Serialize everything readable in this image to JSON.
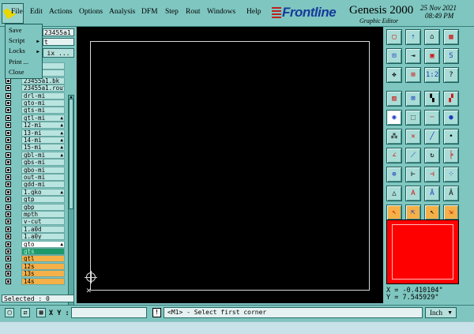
{
  "menubar": {
    "items": [
      "File",
      "Edit",
      "Actions",
      "Options",
      "Analysis",
      "DFM",
      "Step",
      "Rout",
      "Windows",
      "Help"
    ]
  },
  "logo": {
    "brand": "Frontline",
    "product": "Genesis 2000",
    "subtitle": "Graphic Editor",
    "date": "25 Nov 2021",
    "time": "08:49 PM"
  },
  "file_menu": {
    "items": [
      "Save",
      "Script",
      "Locks",
      "Print ...",
      "Close"
    ]
  },
  "left_panel": {
    "job": "23455a1",
    "step": "t",
    "matrix_button": "ix ...",
    "selected_label": "Selected : 0"
  },
  "layers": [
    {
      "name": "1.drl",
      "style": "normal",
      "tag": ""
    },
    {
      "name": ".si",
      "style": "normal",
      "tag": ""
    },
    {
      "name": "23455a1.bk",
      "style": "normal",
      "tag": ""
    },
    {
      "name": "23455a1.rout",
      "style": "normal",
      "tag": ""
    },
    {
      "name": "drl-mi",
      "style": "normal",
      "tag": ""
    },
    {
      "name": "gto-mi",
      "style": "normal",
      "tag": ""
    },
    {
      "name": "gts-mi",
      "style": "normal",
      "tag": ""
    },
    {
      "name": "gtl-mi",
      "style": "normal",
      "tag": "▲"
    },
    {
      "name": "12-mi",
      "style": "normal",
      "tag": "▲"
    },
    {
      "name": "13-mi",
      "style": "normal",
      "tag": "▲"
    },
    {
      "name": "14-mi",
      "style": "normal",
      "tag": "▲"
    },
    {
      "name": "15-mi",
      "style": "normal",
      "tag": "▲"
    },
    {
      "name": "gbl-mi",
      "style": "normal",
      "tag": "▲"
    },
    {
      "name": "gbs-mi",
      "style": "normal",
      "tag": ""
    },
    {
      "name": "gbo-mi",
      "style": "normal",
      "tag": ""
    },
    {
      "name": "out-mi",
      "style": "normal",
      "tag": ""
    },
    {
      "name": "gdd-mi",
      "style": "normal",
      "tag": ""
    },
    {
      "name": "1.gko",
      "style": "normal",
      "tag": "▲"
    },
    {
      "name": "gtp",
      "style": "normal",
      "tag": ""
    },
    {
      "name": "gbp",
      "style": "normal",
      "tag": ""
    },
    {
      "name": "mpth",
      "style": "normal",
      "tag": ""
    },
    {
      "name": "v-cut",
      "style": "normal",
      "tag": ""
    },
    {
      "name": "1.a0d",
      "style": "normal",
      "tag": ""
    },
    {
      "name": "1.a0y",
      "style": "normal",
      "tag": ""
    },
    {
      "name": "gto",
      "style": "white",
      "tag": "▲"
    },
    {
      "name": "gts",
      "style": "green",
      "tag": ""
    },
    {
      "name": "gtl",
      "style": "orange",
      "tag": ""
    },
    {
      "name": "12s",
      "style": "orange",
      "tag": ""
    },
    {
      "name": "13s",
      "style": "orange",
      "tag": ""
    },
    {
      "name": "14s",
      "style": "orange",
      "tag": ""
    }
  ],
  "toolbar": {
    "buttons": [
      {
        "icon": "window-icon",
        "glyph": "▢"
      },
      {
        "icon": "zoom-in-icon",
        "glyph": "⇡"
      },
      {
        "icon": "home-icon",
        "glyph": "⌂"
      },
      {
        "icon": "grid-icon",
        "glyph": "▦"
      },
      {
        "icon": "zoom-home-icon",
        "glyph": "⊡"
      },
      {
        "icon": "pan-icon",
        "glyph": "⇥"
      },
      {
        "icon": "layers-icon",
        "glyph": "▣"
      },
      {
        "icon": "snap-icon",
        "glyph": "S"
      },
      {
        "icon": "move-icon",
        "glyph": "✥"
      },
      {
        "icon": "fit-icon",
        "glyph": "⊞"
      },
      {
        "icon": "scale-icon",
        "glyph": "1:2"
      },
      {
        "icon": "help-icon",
        "glyph": "?"
      },
      {
        "icon": "hatch-icon",
        "glyph": "▨"
      },
      {
        "icon": "measure-icon",
        "glyph": "⊠"
      },
      {
        "icon": "route-red-icon",
        "glyph": "▚"
      },
      {
        "icon": "route-blue-icon",
        "glyph": "▞"
      },
      {
        "icon": "circle-select-icon",
        "glyph": "◉"
      },
      {
        "icon": "dash-icon",
        "glyph": "⬚"
      },
      {
        "icon": "dotted-line-icon",
        "glyph": "┄"
      },
      {
        "icon": "pad-icon",
        "glyph": "●"
      },
      {
        "icon": "nodes-icon",
        "glyph": "⁂"
      },
      {
        "icon": "cross-icon",
        "glyph": "✕"
      },
      {
        "icon": "segment-icon",
        "glyph": "╱"
      },
      {
        "icon": "dot-icon",
        "glyph": "•"
      },
      {
        "icon": "angle-icon",
        "glyph": "∠"
      },
      {
        "icon": "diagonal-icon",
        "glyph": "⟋"
      },
      {
        "icon": "arc-icon",
        "glyph": "↻"
      },
      {
        "icon": "fork-icon",
        "glyph": "╞"
      },
      {
        "icon": "node-add-icon",
        "glyph": "⊕"
      },
      {
        "icon": "line-add-icon",
        "glyph": "⊢"
      },
      {
        "icon": "split-icon",
        "glyph": "⊣"
      },
      {
        "icon": "pads-icon",
        "glyph": "⁘"
      },
      {
        "icon": "triangle-icon",
        "glyph": "△"
      },
      {
        "icon": "a-icon",
        "glyph": "A"
      },
      {
        "icon": "a-flat-icon",
        "glyph": "Ā"
      },
      {
        "icon": "a-arc-icon",
        "glyph": "Â"
      },
      {
        "icon": "pointer-icon",
        "glyph": "↖"
      },
      {
        "icon": "pointer-box-icon",
        "glyph": "⇱"
      },
      {
        "icon": "pointer-circle-icon",
        "glyph": "↖"
      },
      {
        "icon": "pointer-multi-icon",
        "glyph": "⇲"
      }
    ],
    "active_color": "#ff0000"
  },
  "coords": {
    "x_text": "X = -0.410104\"",
    "y_text": "Y = 7.545929\""
  },
  "bottom": {
    "xy_label": "X Y :",
    "xy_value": "",
    "message": "<M1> - Select first corner",
    "units": "Inch"
  }
}
